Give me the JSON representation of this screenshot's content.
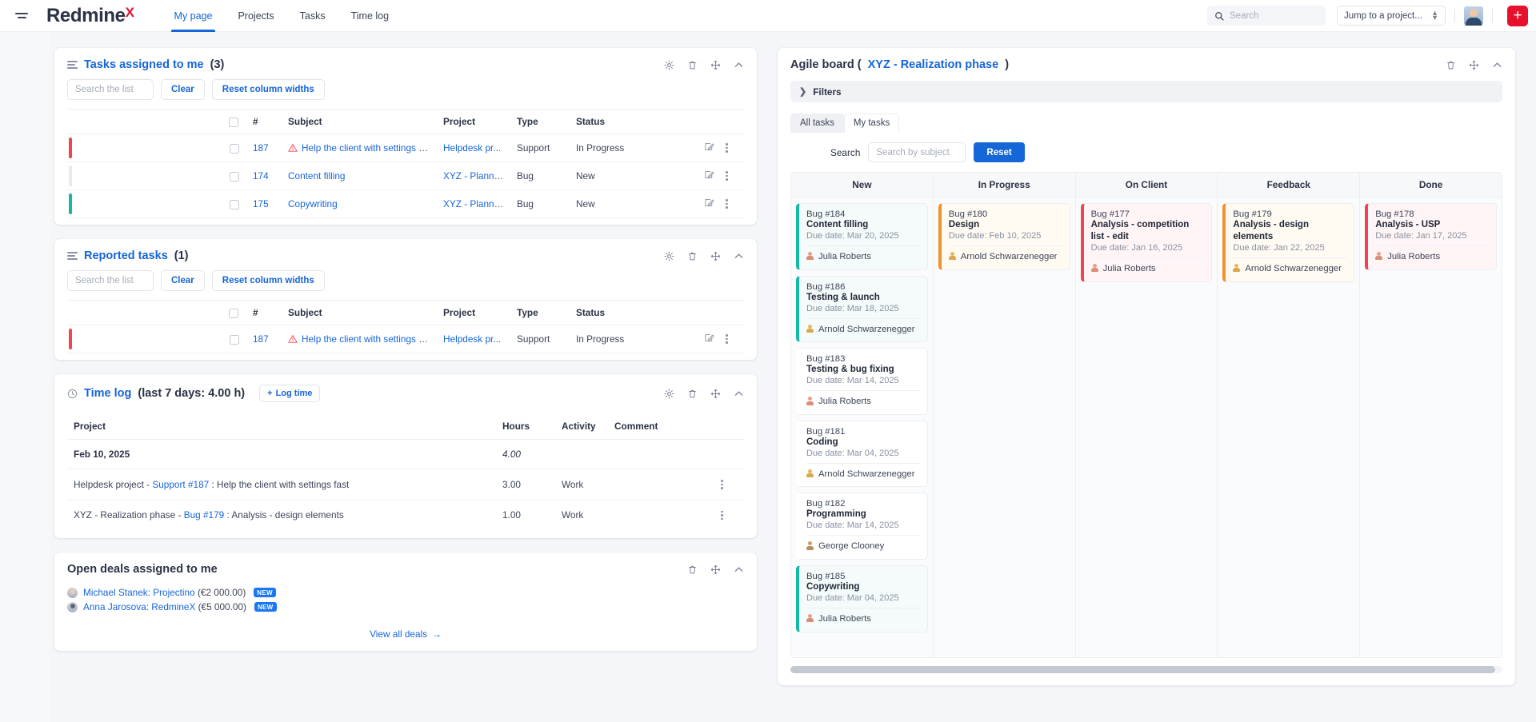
{
  "header": {
    "brand": "Redmine",
    "brand_accent": "X",
    "nav": [
      {
        "label": "My page",
        "active": true
      },
      {
        "label": "Projects",
        "active": false
      },
      {
        "label": "Tasks",
        "active": false
      },
      {
        "label": "Time log",
        "active": false
      }
    ],
    "search_placeholder": "Search",
    "jump_label": "Jump to a project...",
    "add_label": "+"
  },
  "tasks_panel": {
    "title": "Tasks assigned to me",
    "count": "(3)",
    "search_placeholder": "Search the list",
    "clear_label": "Clear",
    "reset_label": "Reset column widths",
    "columns": [
      "#",
      "Subject",
      "Project",
      "Type",
      "Status"
    ],
    "rows": [
      {
        "accent": "#ef4452",
        "id": "187",
        "warn": true,
        "subject": "Help the client with settings fast",
        "project": "Helpdesk pr...",
        "type": "Support",
        "status": "In Progress"
      },
      {
        "accent": "#e8eaee",
        "id": "174",
        "warn": false,
        "subject": "Content filling",
        "project": "XYZ - Planni...",
        "type": "Bug",
        "status": "New"
      },
      {
        "accent": "#14b8a6",
        "id": "175",
        "warn": false,
        "subject": "Copywriting",
        "project": "XYZ - Planni...",
        "type": "Bug",
        "status": "New"
      }
    ]
  },
  "reported_panel": {
    "title": "Reported tasks",
    "count": "(1)",
    "search_placeholder": "Search the list",
    "clear_label": "Clear",
    "reset_label": "Reset column widths",
    "columns": [
      "#",
      "Subject",
      "Project",
      "Type",
      "Status"
    ],
    "rows": [
      {
        "accent": "#ef4452",
        "id": "187",
        "warn": true,
        "subject": "Help the client with settings fast",
        "project": "Helpdesk pr...",
        "type": "Support",
        "status": "In Progress"
      }
    ]
  },
  "timelog_panel": {
    "title": "Time log",
    "subtitle": "(last 7 days: 4.00 h)",
    "log_time_label": "Log time",
    "columns": [
      "Project",
      "Hours",
      "Activity",
      "Comment"
    ],
    "date_group": {
      "date": "Feb 10, 2025",
      "hours": "4.00"
    },
    "rows": [
      {
        "project_prefix": "Helpdesk project - ",
        "link": "Support #187",
        "project_suffix": " : Help the client with settings fast",
        "hours": "3.00",
        "activity": "Work",
        "comment": ""
      },
      {
        "project_prefix": "XYZ - Realization phase - ",
        "link": "Bug #179",
        "project_suffix": " : Analysis - design elements",
        "hours": "1.00",
        "activity": "Work",
        "comment": ""
      }
    ]
  },
  "deals_panel": {
    "title": "Open deals assigned to me",
    "deals": [
      {
        "name": "Michael Stanek: Projectino",
        "amount": "(€2 000.00)",
        "badge": "NEW"
      },
      {
        "name": "Anna Jarosova: RedmineX",
        "amount": "(€5 000.00)",
        "badge": "NEW"
      }
    ],
    "view_all_label": "View all deals"
  },
  "agile_panel": {
    "title_prefix": "Agile board (",
    "title_link": "XYZ - Realization phase",
    "title_suffix": ")",
    "filters_label": "Filters",
    "tabs": [
      {
        "label": "All tasks",
        "active": true
      },
      {
        "label": "My tasks",
        "active": false
      }
    ],
    "search_label": "Search",
    "search_placeholder": "Search by subject",
    "reset_label": "Reset",
    "columns": [
      "New",
      "In Progress",
      "On Client",
      "Feedback",
      "Done"
    ],
    "cards": {
      "new": [
        {
          "id": "Bug #184",
          "title": "Content filling",
          "due": "Due date: Mar 20, 2025",
          "assignee": "Julia Roberts",
          "av": "jr",
          "border": "#14b8a6",
          "bg": "#f4fbfa"
        },
        {
          "id": "Bug #186",
          "title": "Testing & launch",
          "due": "Due date: Mar 18, 2025",
          "assignee": "Arnold Schwarzenegger",
          "av": "as",
          "border": "#14b8a6",
          "bg": "#f4fbfa"
        },
        {
          "id": "Bug #183",
          "title": "Testing & bug fixing",
          "due": "Due date: Mar 14, 2025",
          "assignee": "Julia Roberts",
          "av": "jr",
          "border": "#ffffff",
          "bg": "#ffffff"
        },
        {
          "id": "Bug #181",
          "title": "Coding",
          "due": "Due date: Mar 04, 2025",
          "assignee": "Arnold Schwarzenegger",
          "av": "as",
          "border": "#ffffff",
          "bg": "#ffffff"
        },
        {
          "id": "Bug #182",
          "title": "Programming",
          "due": "Due date: Mar 14, 2025",
          "assignee": "George Clooney",
          "av": "gc",
          "border": "#ffffff",
          "bg": "#ffffff"
        },
        {
          "id": "Bug #185",
          "title": "Copywriting",
          "due": "Due date: Mar 04, 2025",
          "assignee": "Julia Roberts",
          "av": "jr",
          "border": "#14b8a6",
          "bg": "#f4fbfa"
        }
      ],
      "in_progress": [
        {
          "id": "Bug #180",
          "title": "Design",
          "due": "Due date: Feb 10, 2025",
          "assignee": "Arnold Schwarzenegger",
          "av": "as",
          "border": "#f0922b",
          "bg": "#fffaf2"
        }
      ],
      "on_client": [
        {
          "id": "Bug #177",
          "title": "Analysis - competition list - edit",
          "due": "Due date: Jan 16, 2025",
          "assignee": "Julia Roberts",
          "av": "jr",
          "border": "#ef4452",
          "bg": "#fff5f6"
        }
      ],
      "feedback": [
        {
          "id": "Bug #179",
          "title": "Analysis - design elements",
          "due": "Due date: Jan 22, 2025",
          "assignee": "Arnold Schwarzenegger",
          "av": "as",
          "border": "#f0922b",
          "bg": "#fffaf2"
        }
      ],
      "done": [
        {
          "id": "Bug #178",
          "title": "Analysis - USP",
          "due": "Due date: Jan 17, 2025",
          "assignee": "Julia Roberts",
          "av": "jr",
          "border": "#ef4452",
          "bg": "#fff5f6"
        }
      ]
    }
  },
  "colors": {
    "brand_blue": "#1565d8",
    "brand_red": "#e8112d",
    "accent_teal": "#14b8a6",
    "accent_orange": "#f0922b",
    "primary_button": "#1566d6"
  }
}
